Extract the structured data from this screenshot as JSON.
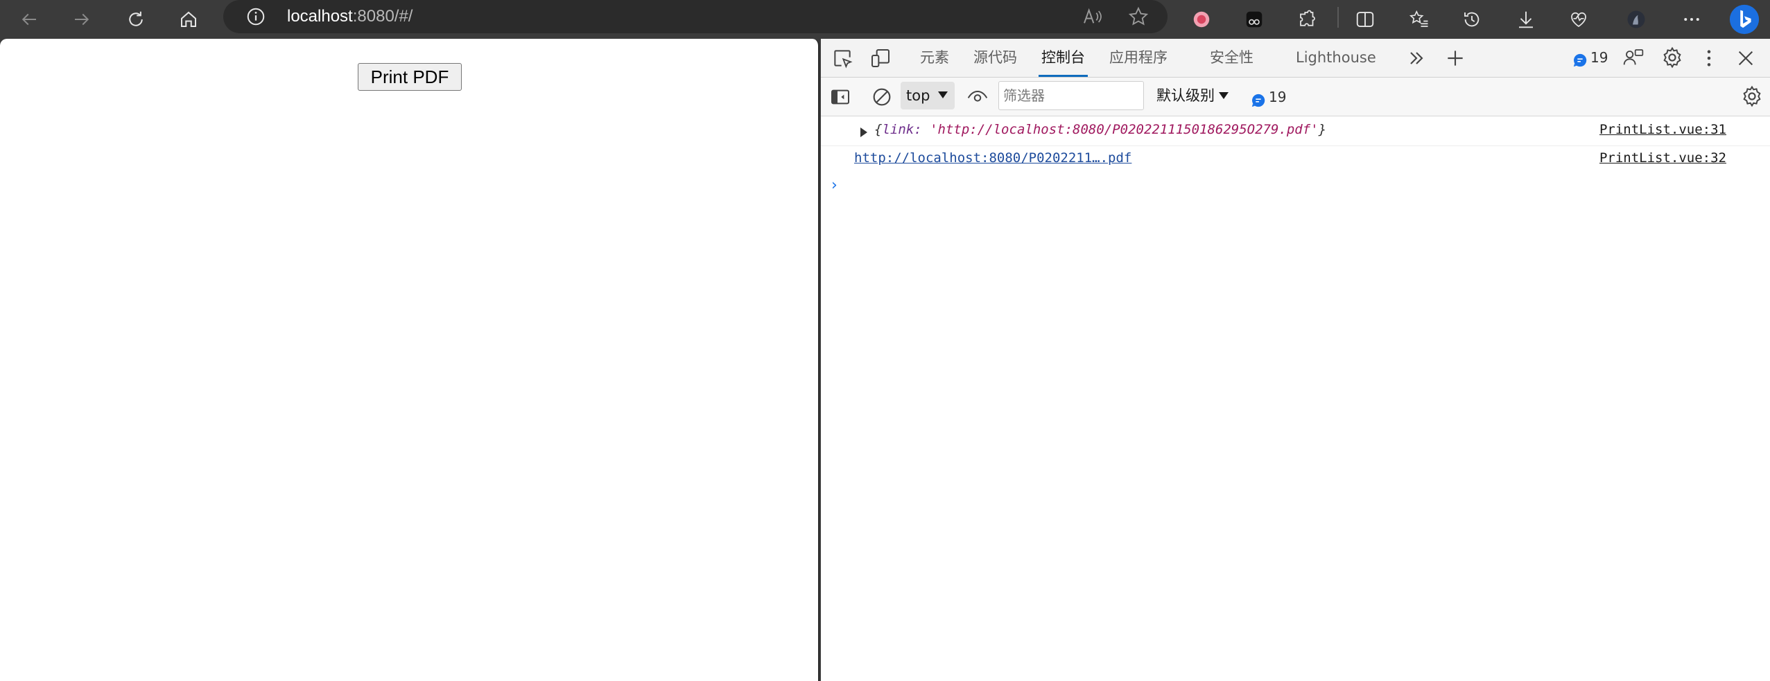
{
  "browser": {
    "url_host": "localhost",
    "url_rest": ":8080/#/"
  },
  "page": {
    "print_button_label": "Print PDF"
  },
  "devtools": {
    "tabs": [
      {
        "label": "元素"
      },
      {
        "label": "源代码"
      },
      {
        "label": "控制台"
      },
      {
        "label": "应用程序"
      },
      {
        "label": "安全性"
      },
      {
        "label": "Lighthouse"
      }
    ],
    "active_tab": "控制台",
    "issues_count": "19",
    "console_toolbar": {
      "context": "top",
      "filter_placeholder": "筛选器",
      "level": "默认级别",
      "messages_count": "19"
    },
    "console": {
      "log1": {
        "open": "{",
        "key": "link:",
        "value": "'http://localhost:8080/P0202211150186295O279.pdf'",
        "close": "}",
        "source": "PrintList.vue:31"
      },
      "log2": {
        "url": "http://localhost:8080/P0202211….pdf",
        "source": "PrintList.vue:32"
      },
      "prompt": "›"
    }
  },
  "colors": {
    "accent": "#0f6cbd",
    "toolbar_bg": "#3b3b3b"
  }
}
